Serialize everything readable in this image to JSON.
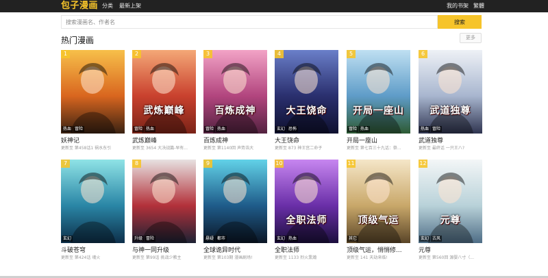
{
  "header": {
    "logo": "包子漫画",
    "nav": [
      "分类",
      "最新上架"
    ],
    "right": [
      "我的书架",
      "繁體"
    ]
  },
  "search": {
    "placeholder": "搜索漫画名、作者名",
    "button": "搜索"
  },
  "section": {
    "title": "热门漫画",
    "more": "更多"
  },
  "comics": [
    {
      "rank": "1",
      "name": "妖神记",
      "update": "更新至 第458话1 祸水东引",
      "tags": [
        "热血",
        "冒险"
      ],
      "cover_text": "",
      "colors": [
        "#f7c04a",
        "#d9661f",
        "#3a2212"
      ]
    },
    {
      "rank": "2",
      "name": "武炼巅峰",
      "update": "更新至 3654 大决战篇-早有...",
      "tags": [
        "冒险",
        "热血"
      ],
      "cover_text": "武炼巅峰",
      "colors": [
        "#f4a877",
        "#c9412e",
        "#7a2317"
      ]
    },
    {
      "rank": "3",
      "name": "百炼成神",
      "update": "更新至 第1140回 声势浩大",
      "tags": [
        "冒险",
        "热血"
      ],
      "cover_text": "百炼成神",
      "colors": [
        "#f2a3c6",
        "#b2457e",
        "#532240"
      ]
    },
    {
      "rank": "4",
      "name": "大王饶命",
      "update": "更新至 873 神王宫二命子",
      "tags": [
        "玄幻",
        "恐怖"
      ],
      "cover_text": "大王饶命",
      "colors": [
        "#6a7fc9",
        "#2a2f6e",
        "#0f1130"
      ]
    },
    {
      "rank": "5",
      "name": "开局一座山",
      "update": "更新至 第七百三十九话：祭...",
      "tags": [
        "冒险",
        "热血"
      ],
      "cover_text": "开局一座山",
      "colors": [
        "#bfe0f2",
        "#5f9cc8",
        "#2e5b34"
      ]
    },
    {
      "rank": "6",
      "name": "武道独尊",
      "update": "更新至 最终话 一只王八?",
      "tags": [
        "热血",
        "冒险"
      ],
      "cover_text": "武道独尊",
      "colors": [
        "#eef1f6",
        "#a8b6cf",
        "#2f3450"
      ]
    },
    {
      "rank": "7",
      "name": "斗破苍穹",
      "update": "更新至 第424话 魂火",
      "tags": [
        "玄幻"
      ],
      "cover_text": "",
      "colors": [
        "#8fe3e6",
        "#2a86a6",
        "#0d2f4a"
      ]
    },
    {
      "rank": "8",
      "name": "与神一同升级",
      "update": "更新至 第99话 挑战少教主",
      "tags": [
        "升级",
        "冒险"
      ],
      "cover_text": "",
      "colors": [
        "#e7e1e1",
        "#b3313a",
        "#1d2234"
      ]
    },
    {
      "rank": "9",
      "name": "全球诡异时代",
      "update": "更新至 第103期 漫画剧场!",
      "tags": [
        "悬疑",
        "都市"
      ],
      "cover_text": "",
      "colors": [
        "#62d2e8",
        "#1f5c8a",
        "#0b1626"
      ]
    },
    {
      "rank": "10",
      "name": "全职法师",
      "update": "更新至 1133 烈火熏瀚",
      "tags": [
        "玄幻",
        "热血"
      ],
      "cover_text": "全职法师",
      "colors": [
        "#c786f0",
        "#6a2fa8",
        "#1c0f3d"
      ]
    },
    {
      "rank": "11",
      "name": "顶级气运，悄悄修...",
      "update": "更新至 141 天劫来临!",
      "tags": [
        "其它"
      ],
      "cover_text": "顶级气运",
      "colors": [
        "#f5e6c8",
        "#c9a86a",
        "#5a4528"
      ]
    },
    {
      "rank": "12",
      "name": "元尊",
      "update": "更新至 第560回 源婴八寸（...",
      "tags": [
        "玄幻",
        "古风"
      ],
      "cover_text": "元尊",
      "colors": [
        "#f3f6f7",
        "#b9d2d9",
        "#4e6d86"
      ]
    }
  ]
}
